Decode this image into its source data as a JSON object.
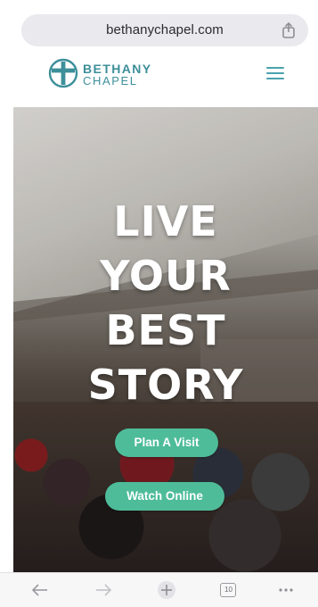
{
  "browser": {
    "url": "bethanychapel.com"
  },
  "site": {
    "logo_line1": "BETHANY",
    "logo_line2": "CHAPEL",
    "brand_color": "#3d8f9a"
  },
  "hero": {
    "title_lines": [
      "LIVE",
      "YOUR",
      "BEST",
      "STORY"
    ],
    "buttons": {
      "plan_label": "Plan A Visit",
      "watch_label": "Watch Online",
      "color": "#4ebc99"
    }
  },
  "toolbar": {
    "tab_count": "10",
    "icons": [
      "back-arrow-icon",
      "forward-arrow-icon",
      "new-tab-icon",
      "tabs-icon",
      "more-icon"
    ]
  }
}
